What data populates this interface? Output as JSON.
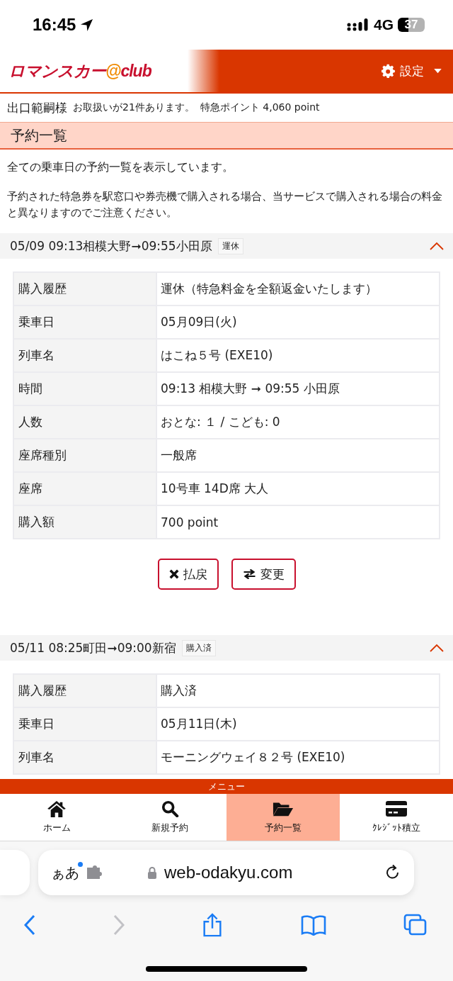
{
  "status_bar": {
    "time": "16:45",
    "network": "4G",
    "battery": "37"
  },
  "header": {
    "logo": [
      {
        "text": "ロマンスカー",
        "color": "#c8102e"
      },
      {
        "text": "@",
        "color": "#f08a00"
      },
      {
        "text": "club",
        "color": "#c8102e"
      }
    ],
    "settings_label": "設定"
  },
  "account": {
    "name": "出口範嗣様",
    "count_text": "お取扱いが21件あります。",
    "points_text": "特急ポイント 4,060 point"
  },
  "page_title": "予約一覧",
  "intro": "全ての乗車日の予約一覧を表示しています。",
  "notice": "予約された特急券を駅窓口や券売機で購入される場合、当サービスで購入される場合の料金と異なりますのでご注意ください。",
  "reservations": [
    {
      "title": "05/09 09:13相模大野➞09:55小田原",
      "badge": "運休",
      "expanded": true,
      "rows": [
        {
          "label": "購入履歴",
          "value": "運休（特急料金を全額返金いたします）"
        },
        {
          "label": "乗車日",
          "value": "05月09日(火)"
        },
        {
          "label": "列車名",
          "value": "はこね５号 (EXE10)"
        },
        {
          "label": "時間",
          "value": "09:13 相模大野 ➞ 09:55 小田原"
        },
        {
          "label": "人数",
          "value": "おとな: １ / こども: 0"
        },
        {
          "label": "座席種別",
          "value": "一般席"
        },
        {
          "label": "座席",
          "value": "10号車 14D席 大人"
        },
        {
          "label": "購入額",
          "value": "700 point"
        }
      ],
      "buttons": [
        {
          "kind": "refund",
          "label": "払戻"
        },
        {
          "kind": "change",
          "label": "変更"
        }
      ]
    },
    {
      "title": "05/11 08:25町田➞09:00新宿",
      "badge": "購入済",
      "expanded": true,
      "rows": [
        {
          "label": "購入履歴",
          "value": "購入済"
        },
        {
          "label": "乗車日",
          "value": "05月11日(木)"
        },
        {
          "label": "列車名",
          "value": "モーニングウェイ８２号 (EXE10)"
        }
      ]
    }
  ],
  "menu": {
    "title": "メニュー",
    "items": [
      {
        "kind": "home",
        "label": "ホーム",
        "selected": false
      },
      {
        "kind": "search",
        "label": "新規予約",
        "selected": false
      },
      {
        "kind": "folder",
        "label": "予約一覧",
        "selected": true
      },
      {
        "kind": "card",
        "label": "ｸﾚｼﾞｯﾄ積立",
        "selected": false
      }
    ]
  },
  "browser": {
    "text_size": "ぁあ",
    "url": "web-odakyu.com",
    "toolbar": [
      {
        "kind": "back",
        "disabled": false
      },
      {
        "kind": "forward",
        "disabled": true
      },
      {
        "kind": "share",
        "disabled": false
      },
      {
        "kind": "bookmarks",
        "disabled": false
      },
      {
        "kind": "tabs",
        "disabled": false
      }
    ]
  }
}
